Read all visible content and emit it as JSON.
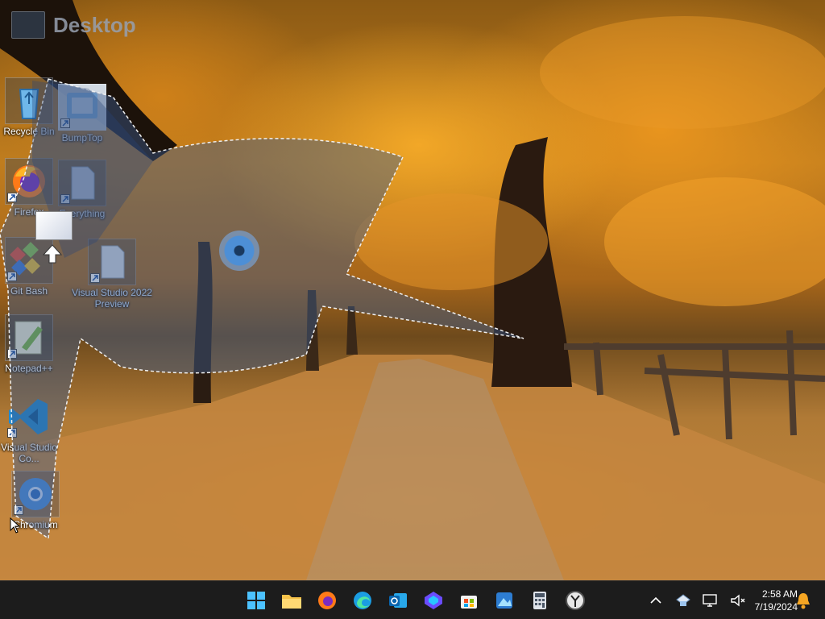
{
  "desktop": {
    "label": "Desktop"
  },
  "icons": [
    {
      "label": "Recycle Bin"
    },
    {
      "label": "BumpTop"
    },
    {
      "label": "Firefox"
    },
    {
      "label": "Everything"
    },
    {
      "label": "Git Bash"
    },
    {
      "label": "Visual Studio 2022 Preview"
    },
    {
      "label": "Notepad++"
    },
    {
      "label": "Visual Studio Co..."
    },
    {
      "label": "Chromium"
    }
  ],
  "taskbar": {
    "apps": [
      "start-button",
      "file-explorer",
      "firefox",
      "edge",
      "outlook",
      "copilot",
      "microsoft-store",
      "photos",
      "calculator",
      "clock-app"
    ],
    "clock": {
      "time": "2:58 AM",
      "date": "7/19/2024"
    }
  },
  "colors": {
    "taskbar": "#1c1c1c",
    "accent": "#0078d4",
    "lasso_fill": "#3c5a8c"
  }
}
